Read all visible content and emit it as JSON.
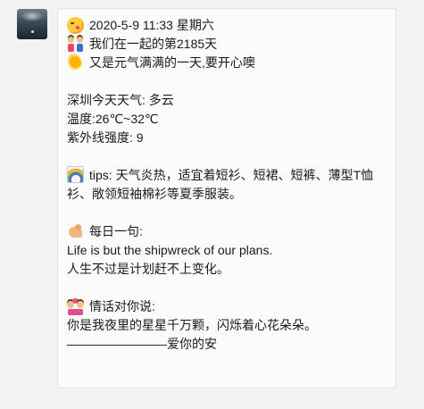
{
  "message": {
    "datetime_line": "2020-5-9 11:33 星期六",
    "together_line": "我们在一起的第2185天",
    "greeting_line": "又是元气满满的一天,要开心噢",
    "weather_city_line": "深圳今天天气: 多云",
    "temperature_line": "温度:26℃~32℃",
    "uv_line": "紫外线强度: 9",
    "tips_text": "tips: 天气炎热，适宜着短衫、短裙、短裤、薄型T恤衫、敞领短袖棉衫等夏季服装。",
    "daily_quote_heading": "每日一句:",
    "daily_quote_en": "Life is but the shipwreck of our plans.",
    "daily_quote_zh": "人生不过是计划赶不上变化。",
    "love_heading": "情话对你说:",
    "love_line": "你是我夜里的星星千万颗，闪烁着心花朵朵。",
    "signature_line": "————————爱你的安"
  },
  "icons": {
    "datetime": "kissing-face-icon",
    "together": "couple-icon",
    "greeting": "sun-icon",
    "tips": "rainbow-icon",
    "quote": "flexed-biceps-icon",
    "love": "couple-with-heart-icon"
  }
}
